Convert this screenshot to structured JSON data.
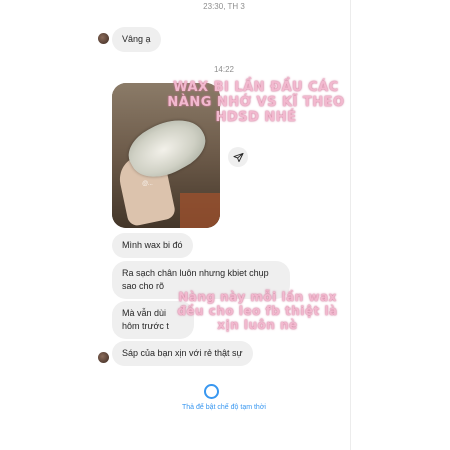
{
  "header": {
    "date_label": "23:30, TH 3"
  },
  "thread": {
    "reply_1": "Vâng ạ",
    "time_divider": "14:22",
    "photo_watermark": "@...",
    "messages": [
      "Mình wax bi đó",
      "Ra sạch chân luôn nhưng kbiet chụp\nsao cho rõ",
      "Mà vẫn dùi\nhôm trước t",
      "Sáp của bạn xịn với rẻ thật sự"
    ]
  },
  "overlay": {
    "top_text": "WAX BI LẦN ĐẦU CÁC NÀNG NHỚ VS KĨ THEO HDSD NHÉ",
    "mid_text": "Nàng này mỗi lần wax đều cho leo fb thiệt là xịn luôn nè"
  },
  "footer": {
    "vanish_mode": "Thả để bật chế độ tạm thời"
  },
  "colors": {
    "accent": "#3897f0",
    "bubble": "#efefef",
    "overlay_text": "#f2b9cf"
  }
}
